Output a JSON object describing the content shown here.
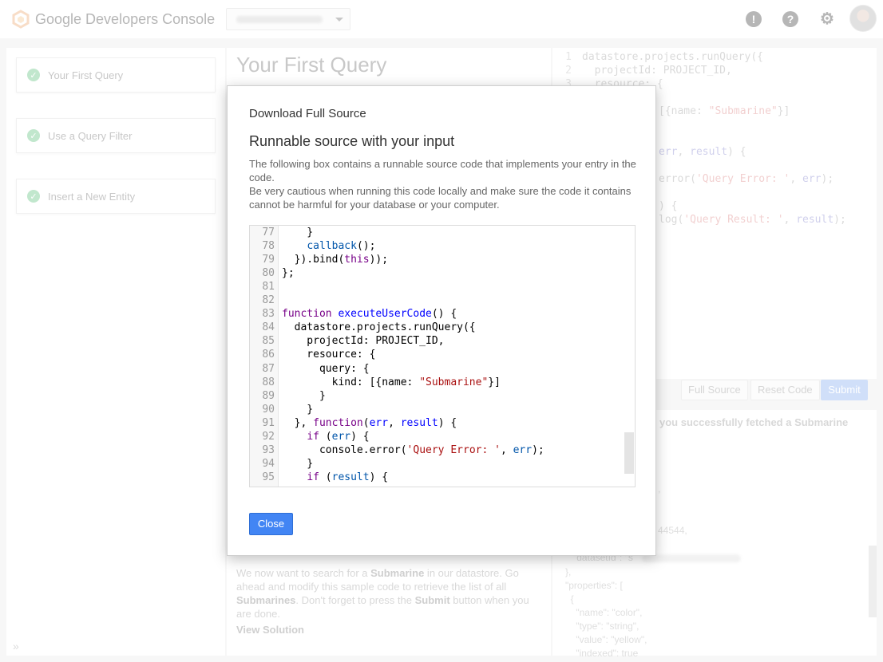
{
  "header": {
    "app_title": "Google Developers Console",
    "icons": [
      "feedback-icon",
      "help-icon",
      "settings-icon"
    ]
  },
  "sidebar": {
    "steps": [
      {
        "label": "Your First Query",
        "status": "completed"
      },
      {
        "label": "Use a Query Filter",
        "status": "completed"
      },
      {
        "label": "Insert a New Entity",
        "status": "completed"
      }
    ],
    "collapse_glyph": "»"
  },
  "content": {
    "title": "Your First Query",
    "para_1": "We now want to search for a ",
    "para_b1": "Submarine",
    "para_2": " in our datastore. Go ahead and modify this sample code to retrieve the list of all ",
    "para_b2": "Submarines",
    "para_3": ". Don't forget to press the ",
    "para_b3": "Submit",
    "para_4": " button when you are done.",
    "view_solution": "View Solution"
  },
  "editor_bg": {
    "lines": [
      {
        "n": "1",
        "text": "datastore.projects.runQuery({"
      },
      {
        "n": "2",
        "text": "  projectId: PROJECT_ID,"
      },
      {
        "n": "3",
        "text": "  resource: {"
      }
    ],
    "fragments": {
      "f1_pre": "[{name: ",
      "f1_str": "\"Submarine\"",
      "f1_post": "}]",
      "f2_var1": "err",
      "f2_mid": ", ",
      "f2_var2": "result",
      "f2_post": ") {",
      "f3_pre": "error(",
      "f3_str": "'Query Error: '",
      "f3_mid": ", ",
      "f3_var": "err",
      "f3_post": ");",
      "f4": ") {",
      "f5_pre": "log(",
      "f5_str": "'Query Result: '",
      "f5_mid": ", ",
      "f5_var": "result",
      "f5_post": ");"
    }
  },
  "actions": {
    "full_source": "Full Source",
    "reset_code": "Reset Code",
    "submit": "Submit"
  },
  "result_bg": {
    "message": "you successfully fetched a Submarine",
    "frag_comma": ",",
    "frag_num": "44544,",
    "frag_datasetid": "\"datasetId\": \"s",
    "json_lines": [
      "},",
      "\"properties\": [",
      "  {",
      "    \"name\": \"color\",",
      "    \"type\": \"string\",",
      "    \"value\": \"yellow\",",
      "    \"indexed\": true"
    ]
  },
  "modal": {
    "title": "Download Full Source",
    "subtitle": "Runnable source with your input",
    "desc_1": "The following box contains a runnable source code that implements your entry in the code.",
    "desc_2": "Be very cautious when running this code locally and make sure the code it contains cannot be harmful for your database or your computer.",
    "close_label": "Close",
    "code": [
      {
        "n": "77",
        "segs": [
          [
            "",
            "    }"
          ]
        ]
      },
      {
        "n": "78",
        "segs": [
          [
            "",
            "    "
          ],
          [
            "vr",
            "callback"
          ],
          [
            "",
            "();"
          ]
        ]
      },
      {
        "n": "79",
        "segs": [
          [
            "",
            "  }).bind("
          ],
          [
            "kw",
            "this"
          ],
          [
            "",
            "));"
          ]
        ]
      },
      {
        "n": "80",
        "segs": [
          [
            "",
            "};"
          ]
        ]
      },
      {
        "n": "81",
        "segs": [
          [
            "",
            ""
          ]
        ]
      },
      {
        "n": "82",
        "segs": [
          [
            "",
            ""
          ]
        ]
      },
      {
        "n": "83",
        "segs": [
          [
            "kw",
            "function"
          ],
          [
            "",
            " "
          ],
          [
            "df",
            "executeUserCode"
          ],
          [
            "",
            "() {"
          ]
        ]
      },
      {
        "n": "84",
        "segs": [
          [
            "",
            "  datastore.projects.runQuery({"
          ]
        ]
      },
      {
        "n": "85",
        "segs": [
          [
            "",
            "    projectId: PROJECT_ID,"
          ]
        ]
      },
      {
        "n": "86",
        "segs": [
          [
            "",
            "    resource: {"
          ]
        ]
      },
      {
        "n": "87",
        "segs": [
          [
            "",
            "      query: {"
          ]
        ]
      },
      {
        "n": "88",
        "segs": [
          [
            "",
            "        kind: [{name: "
          ],
          [
            "st",
            "\"Submarine\""
          ],
          [
            "",
            "}]"
          ]
        ]
      },
      {
        "n": "89",
        "segs": [
          [
            "",
            "      }"
          ]
        ]
      },
      {
        "n": "90",
        "segs": [
          [
            "",
            "    }"
          ]
        ]
      },
      {
        "n": "91",
        "segs": [
          [
            "",
            "  }, "
          ],
          [
            "kw",
            "function"
          ],
          [
            "",
            "("
          ],
          [
            "df",
            "err"
          ],
          [
            "",
            ", "
          ],
          [
            "df",
            "result"
          ],
          [
            "",
            ") {"
          ]
        ]
      },
      {
        "n": "92",
        "segs": [
          [
            "",
            "    "
          ],
          [
            "kw",
            "if"
          ],
          [
            "",
            " ("
          ],
          [
            "vr",
            "err"
          ],
          [
            "",
            ") {"
          ]
        ]
      },
      {
        "n": "93",
        "segs": [
          [
            "",
            "      console.error("
          ],
          [
            "st",
            "'Query Error: '"
          ],
          [
            "",
            ", "
          ],
          [
            "vr",
            "err"
          ],
          [
            "",
            ");"
          ]
        ]
      },
      {
        "n": "94",
        "segs": [
          [
            "",
            "    }"
          ]
        ]
      },
      {
        "n": "95",
        "segs": [
          [
            "",
            "    "
          ],
          [
            "kw",
            "if"
          ],
          [
            "",
            " ("
          ],
          [
            "vr",
            "result"
          ],
          [
            "",
            ") {"
          ]
        ]
      }
    ]
  }
}
